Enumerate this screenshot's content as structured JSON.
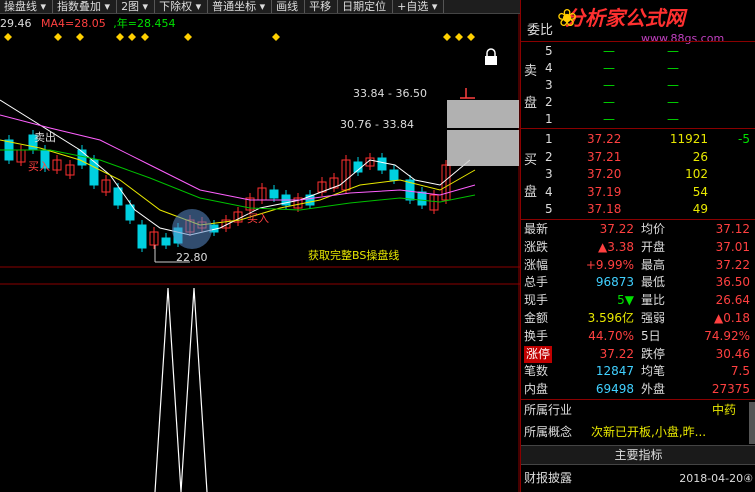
{
  "toolbar": {
    "items": [
      "操盘线 ▾",
      "指数叠加 ▾",
      "2图 ▾",
      "下除权 ▾",
      "普通坐标 ▾",
      "画线",
      "平移",
      "日期定位",
      "+自选 ▾"
    ]
  },
  "ma_bar": {
    "ma3": "29.46",
    "ma4_label": "MA4=",
    "ma4": "28.05",
    "year_label": "年=",
    "year": "28.454"
  },
  "chart": {
    "annot_top": "33.84 - 36.50",
    "annot_mid": "30.76 - 33.84",
    "low_label": "22.80",
    "sell_label": "卖出",
    "buy_label": "买入",
    "buy_label2": "买入",
    "promo": "获取完整BS操盘线"
  },
  "panel": {
    "header": {
      "label": "委比",
      "brand": "分析家公式网",
      "url": "www.88gs.com"
    },
    "sell_side": "卖盘",
    "sells": [
      {
        "n": "5",
        "p": "—",
        "v": "—"
      },
      {
        "n": "4",
        "p": "—",
        "v": "—"
      },
      {
        "n": "3",
        "p": "—",
        "v": "—"
      },
      {
        "n": "2",
        "p": "—",
        "v": "—"
      },
      {
        "n": "1",
        "p": "—",
        "v": "—"
      }
    ],
    "buy_side": "买盘",
    "buys": [
      {
        "n": "1",
        "p": "37.22",
        "v": "11921",
        "d": "-5"
      },
      {
        "n": "2",
        "p": "37.21",
        "v": "26",
        "d": ""
      },
      {
        "n": "3",
        "p": "37.20",
        "v": "102",
        "d": ""
      },
      {
        "n": "4",
        "p": "37.19",
        "v": "54",
        "d": ""
      },
      {
        "n": "5",
        "p": "37.18",
        "v": "49",
        "d": ""
      }
    ],
    "stats": [
      {
        "k1": "最新",
        "v1": "37.22",
        "k2": "均价",
        "v2": "37.12"
      },
      {
        "k1": "涨跌",
        "v1": "▲3.38",
        "k2": "开盘",
        "v2": "37.01"
      },
      {
        "k1": "涨幅",
        "v1": "+9.99%",
        "k2": "最高",
        "v2": "37.22"
      },
      {
        "k1": "总手",
        "v1": "96873",
        "k2": "最低",
        "v2": "36.50"
      },
      {
        "k1": "现手",
        "v1": "5▼",
        "k2": "量比",
        "v2": "26.64"
      },
      {
        "k1": "金额",
        "v1": "3.596亿",
        "k2": "强弱",
        "v2": "▲0.18"
      },
      {
        "k1": "换手",
        "v1": "44.70%",
        "k2": "5日",
        "v2": "74.92%"
      },
      {
        "k1": "涨停",
        "v1": "37.22",
        "k2": "跌停",
        "v2": "30.46"
      },
      {
        "k1": "笔数",
        "v1": "12847",
        "k2": "均笔",
        "v2": "7.5"
      },
      {
        "k1": "内盘",
        "v1": "69498",
        "k2": "外盘",
        "v2": "27375"
      }
    ],
    "industry_label": "所属行业",
    "industry": "中药",
    "concept_label": "所属概念",
    "concept": "次新已开板,小盘,昨...",
    "main_indicator": "主要指标",
    "disclosure_label": "财报披露",
    "disclosure_date": "2018-04-20④"
  }
}
